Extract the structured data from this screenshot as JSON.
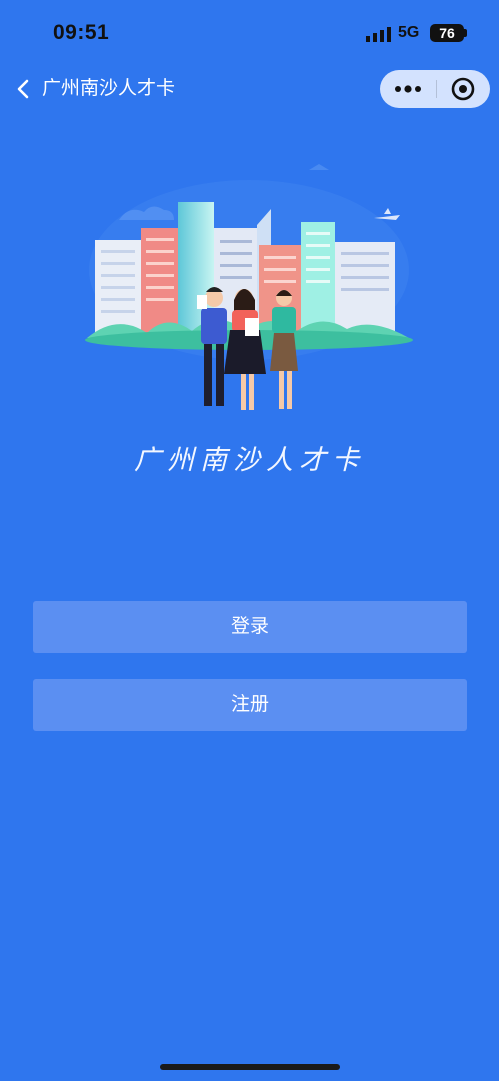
{
  "status_bar": {
    "time": "09:51",
    "network": "5G",
    "battery": "76"
  },
  "nav": {
    "title": "广州南沙人才卡"
  },
  "hero": {
    "title": "广州南沙人才卡"
  },
  "actions": {
    "login_label": "登录",
    "register_label": "注册"
  },
  "icons": [
    "signal-icon",
    "battery-icon",
    "back-arrow-icon",
    "more-icon",
    "close-circle-icon",
    "city-illustration"
  ],
  "colors": {
    "background": "#2f76ee",
    "button": "#5b8ff2"
  }
}
